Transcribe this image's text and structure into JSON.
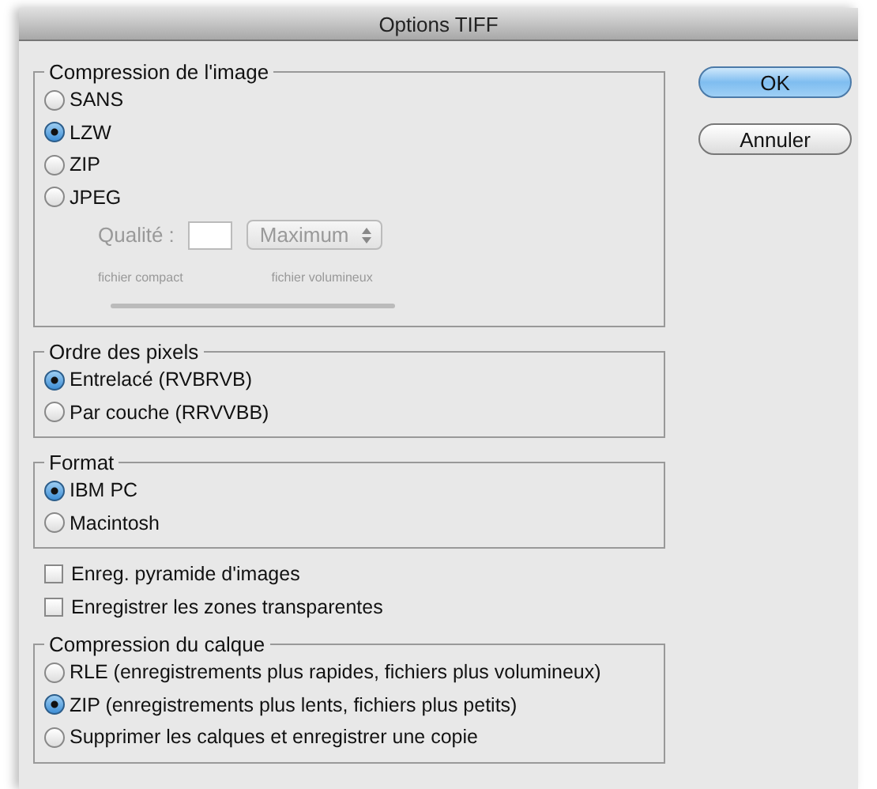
{
  "window": {
    "title": "Options TIFF"
  },
  "sections": [
    {
      "kind": "radio_group",
      "title": "Compression de l'image",
      "options": [
        {
          "label": "SANS",
          "selected": false
        },
        {
          "label": "LZW",
          "selected": true
        },
        {
          "label": "ZIP",
          "selected": false
        },
        {
          "label": "JPEG",
          "selected": false
        }
      ],
      "quality": {
        "disabled": true,
        "label": "Qualité :",
        "preset": "Maximum",
        "min_label": "fichier compact",
        "max_label": "fichier volumineux"
      }
    },
    {
      "kind": "radio_group",
      "title": "Ordre des pixels",
      "options": [
        {
          "label": "Entrelacé (RVBRVB)",
          "selected": true
        },
        {
          "label": "Par couche (RRVVBB)",
          "selected": false
        }
      ]
    },
    {
      "kind": "radio_group",
      "title": "Format",
      "options": [
        {
          "label": "IBM PC",
          "selected": true
        },
        {
          "label": "Macintosh",
          "selected": false
        }
      ]
    },
    {
      "kind": "checkboxes",
      "items": [
        {
          "label": "Enreg. pyramide d'images",
          "checked": false
        },
        {
          "label": "Enregistrer les zones transparentes",
          "checked": false
        }
      ]
    },
    {
      "kind": "radio_group",
      "title": "Compression du calque",
      "options": [
        {
          "label": "RLE (enregistrements plus rapides, fichiers plus volumineux)",
          "selected": false
        },
        {
          "label": "ZIP (enregistrements plus lents, fichiers plus petits)",
          "selected": true
        },
        {
          "label": "Supprimer les calques et enregistrer une copie",
          "selected": false
        }
      ]
    }
  ],
  "buttons": [
    {
      "label": "OK",
      "default": true
    },
    {
      "label": "Annuler",
      "default": false
    }
  ]
}
